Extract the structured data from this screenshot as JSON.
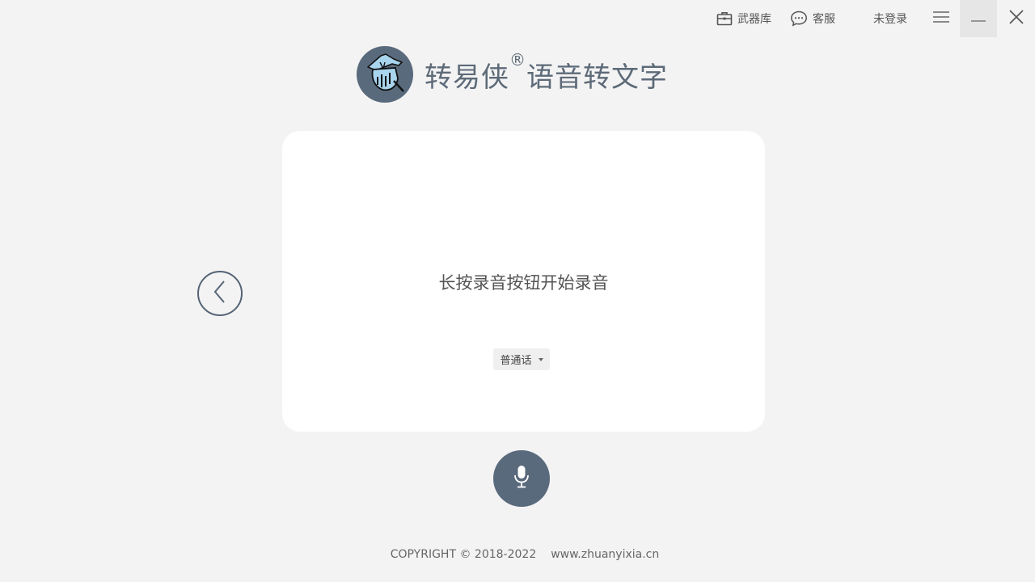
{
  "titlebar": {
    "arsenal_label": "武器库",
    "service_label": "客服",
    "login_label": "未登录"
  },
  "brand": {
    "title": "转易侠",
    "registered_mark": "®",
    "subtitle": "语音转文字",
    "logo_color": "#5a6a7d",
    "logo_accent": "#a8d4ee"
  },
  "panel": {
    "hint": "长按录音按钮开始录音",
    "language_selected": "普通话"
  },
  "footer": {
    "copyright": "COPYRIGHT © 2018-2022",
    "site": "www.zhuanyixia.cn"
  },
  "colors": {
    "background": "#f3f3f3",
    "panel": "#ffffff",
    "accent": "#5a6a7d"
  },
  "icons": {
    "arsenal": "toolbox-icon",
    "service": "chat-bubble-icon",
    "menu": "hamburger-icon",
    "minimize": "minimize-icon",
    "close": "close-icon",
    "back": "chevron-left-icon",
    "mic": "microphone-icon"
  }
}
